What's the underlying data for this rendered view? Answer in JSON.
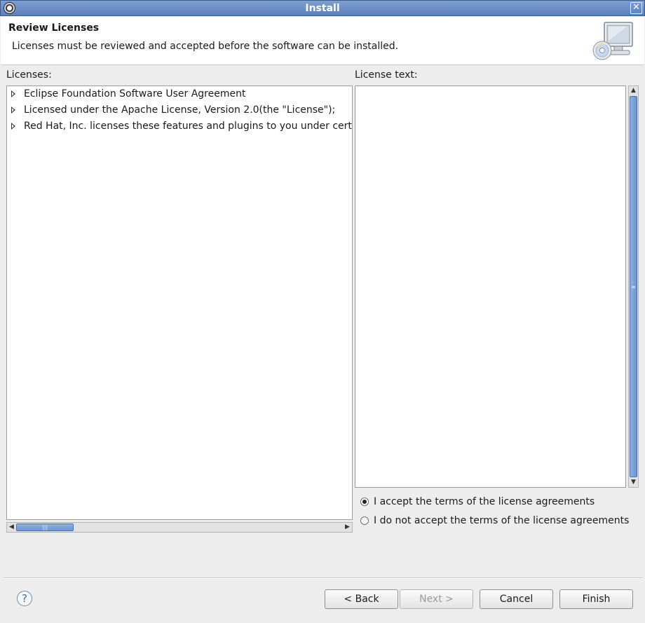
{
  "window": {
    "title": "Install",
    "close_glyph": "✕"
  },
  "header": {
    "title": "Review Licenses",
    "description": "Licenses must be reviewed and accepted before the software can be installed.",
    "icon": "monitor-cd-icon"
  },
  "licenses": {
    "label": "Licenses:",
    "items": [
      {
        "label": "Eclipse Foundation Software User Agreement"
      },
      {
        "label": "Licensed under the Apache License, Version 2.0(the \"License\");"
      },
      {
        "label": "Red Hat, Inc. licenses these features and plugins to you under certain open source licenses"
      }
    ]
  },
  "license_text": {
    "label": "License text:",
    "content": ""
  },
  "acceptance": {
    "accept_label": "I accept the terms of the license agreements",
    "decline_label": "I do not accept the terms of the license agreements",
    "selected": "accept"
  },
  "buttons": {
    "help": "?",
    "back": "< Back",
    "next": "Next >",
    "cancel": "Cancel",
    "finish": "Finish"
  },
  "colors": {
    "titlebar": "#5a7fbf",
    "scroll_thumb": "#6d95cf"
  }
}
